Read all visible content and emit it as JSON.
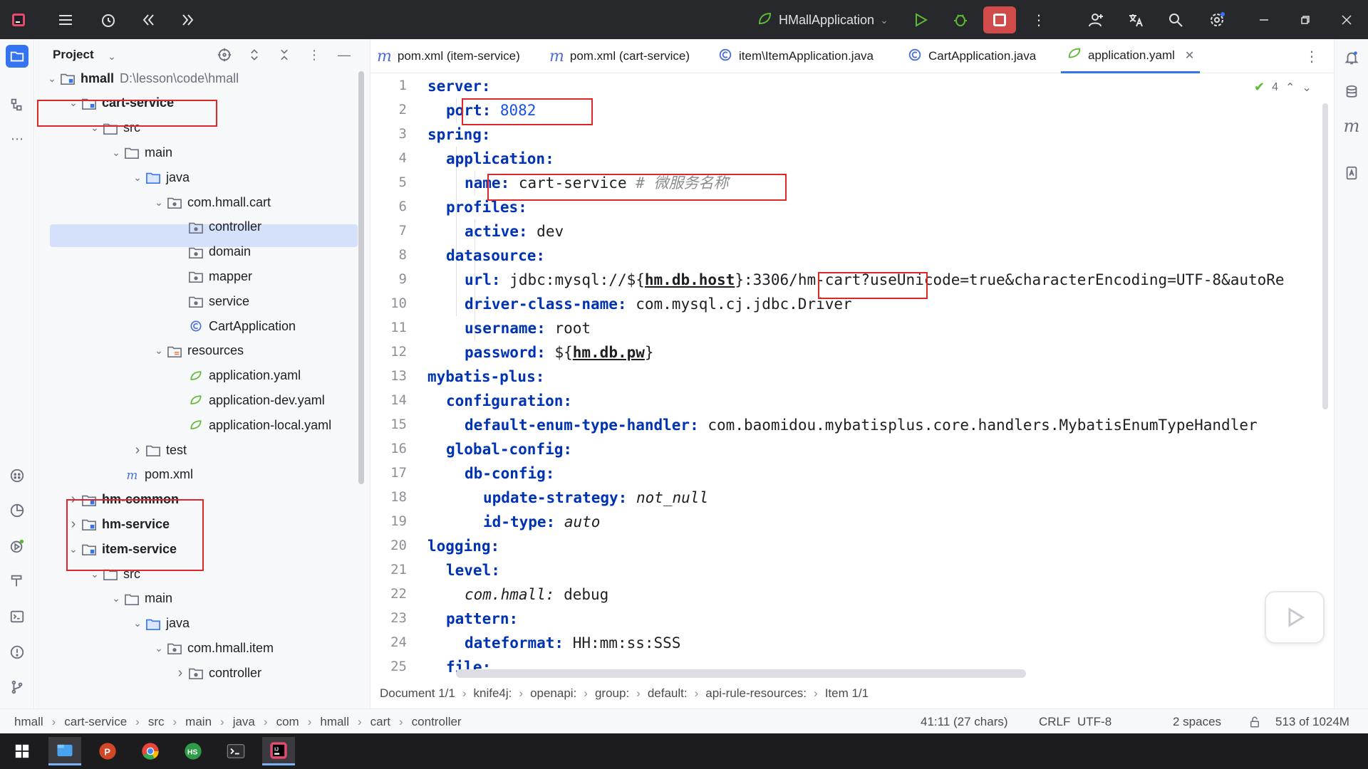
{
  "titlebar": {
    "run_config": "HMallApplication",
    "icons": [
      "app-logo-icon",
      "main-menu-icon",
      "recent-icon",
      "back-icon",
      "forward-icon",
      "run-icon",
      "debug-icon",
      "stop-icon",
      "more-icon",
      "account-icon",
      "translate-icon",
      "search-icon",
      "settings-icon",
      "minimize-icon",
      "restore-icon",
      "close-icon"
    ]
  },
  "project": {
    "title": "Project",
    "tree": [
      {
        "label": "hmall",
        "path": "D:\\lesson\\code\\hmall",
        "bold": true
      },
      {
        "label": "cart-service",
        "bold": true
      },
      {
        "label": "src"
      },
      {
        "label": "main"
      },
      {
        "label": "java"
      },
      {
        "label": "com.hmall.cart"
      },
      {
        "label": "controller"
      },
      {
        "label": "domain"
      },
      {
        "label": "mapper"
      },
      {
        "label": "service"
      },
      {
        "label": "CartApplication"
      },
      {
        "label": "resources"
      },
      {
        "label": "application.yaml"
      },
      {
        "label": "application-dev.yaml"
      },
      {
        "label": "application-local.yaml"
      },
      {
        "label": "test"
      },
      {
        "label": "pom.xml"
      },
      {
        "label": "hm-common",
        "bold": true
      },
      {
        "label": "hm-service",
        "bold": true
      },
      {
        "label": "item-service",
        "bold": true
      },
      {
        "label": "src"
      },
      {
        "label": "main"
      },
      {
        "label": "java"
      },
      {
        "label": "com.hmall.item"
      },
      {
        "label": "controller"
      }
    ]
  },
  "tabs": [
    {
      "label": "pom.xml (item-service)"
    },
    {
      "label": "pom.xml (cart-service)"
    },
    {
      "label": "item\\ItemApplication.java"
    },
    {
      "label": "CartApplication.java"
    },
    {
      "label": "application.yaml"
    }
  ],
  "editor": {
    "inspection_count": "4",
    "line_numbers": [
      "1",
      "2",
      "3",
      "4",
      "5",
      "6",
      "7",
      "8",
      "9",
      "10",
      "11",
      "12",
      "13",
      "14",
      "15",
      "16",
      "17",
      "18",
      "19",
      "20",
      "21",
      "22",
      "23",
      "24",
      "25"
    ],
    "code": {
      "l1": "server:",
      "l2k": "port:",
      "l2v": "8082",
      "l3": "spring:",
      "l4": "application:",
      "l5k": "name:",
      "l5v": "cart-service",
      "l5c": "# 微服务名称",
      "l6": "profiles:",
      "l7k": "active:",
      "l7v": "dev",
      "l8": "datasource:",
      "l9k": "url:",
      "l9a": "jdbc:mysql://${",
      "l9r": "hm.db.host",
      "l9b": "}:3306/hm-cart?useUnicode=true&characterEncoding=UTF-8&autoRe",
      "l10k": "driver-class-name:",
      "l10v": "com.mysql.cj.jdbc.Driver",
      "l11k": "username:",
      "l11v": "root",
      "l12k": "password:",
      "l12a": "${",
      "l12r": "hm.db.pw",
      "l12b": "}",
      "l13": "mybatis-plus:",
      "l14": "configuration:",
      "l15k": "default-enum-type-handler:",
      "l15v": "com.baomidou.mybatisplus.core.handlers.MybatisEnumTypeHandler",
      "l16": "global-config:",
      "l17": "db-config:",
      "l18k": "update-strategy:",
      "l18v": "not_null",
      "l19k": "id-type:",
      "l19v": "auto",
      "l20": "logging:",
      "l21": "level:",
      "l22k": "com.hmall:",
      "l22v": "debug",
      "l23": "pattern:",
      "l24k": "dateformat:",
      "l24v": "HH:mm:ss:SSS",
      "l25": "file:"
    }
  },
  "doc_crumbs": [
    "Document 1/1",
    "knife4j:",
    "openapi:",
    "group:",
    "default:",
    "api-rule-resources:",
    "Item 1/1"
  ],
  "status": {
    "crumbs": [
      "hmall",
      "cart-service",
      "src",
      "main",
      "java",
      "com",
      "hmall",
      "cart",
      "controller"
    ],
    "position": "41:11 (27 chars)",
    "line_sep": "CRLF",
    "encoding": "UTF-8",
    "indent": "2 spaces",
    "memory": "513 of 1024M"
  },
  "colors": {
    "accent": "#3574f0",
    "highlight_box": "#e0262b",
    "yaml_key": "#0033b3",
    "stop_button": "#d14b4b"
  }
}
